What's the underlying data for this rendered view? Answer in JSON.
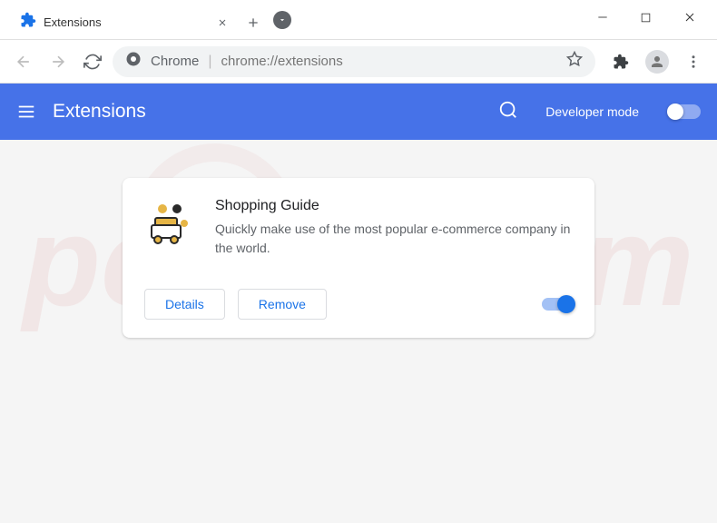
{
  "titlebar": {
    "tab_title": "Extensions"
  },
  "addressbar": {
    "chrome_label": "Chrome",
    "url": "chrome://extensions"
  },
  "header": {
    "title": "Extensions",
    "dev_mode_label": "Developer mode"
  },
  "extension": {
    "name": "Shopping Guide",
    "description": "Quickly make use of the most popular e-commerce company in the world.",
    "details_label": "Details",
    "remove_label": "Remove"
  },
  "watermark": "pcrisk.com"
}
